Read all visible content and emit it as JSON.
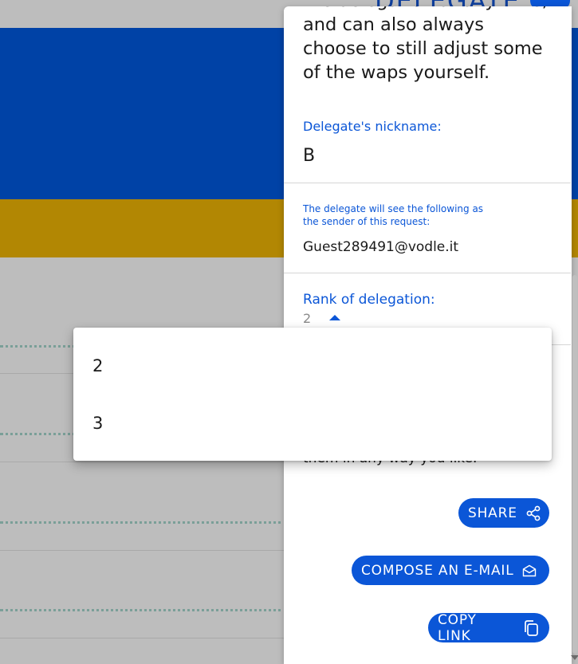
{
  "header": {
    "title": "DELEGATE"
  },
  "panel": {
    "intro_lines": [
      "the delegation at any time,",
      "and can also always",
      "choose to still adjust some",
      "of the waps yourself."
    ],
    "nickname_label": "Delegate's nickname:",
    "nickname_value": "B",
    "sender_label_line1": "The delegate will see the following as",
    "sender_label_line2": "the sender of this request:",
    "sender_value": "Guest289491@vodle.it",
    "rank_label": "Rank of delegation:",
    "rank_value": "2",
    "hidden_text": "them in any way you like.",
    "buttons": {
      "share": "SHARE",
      "email": "COMPOSE AN E-MAIL",
      "copy": "COPY LINK"
    }
  },
  "dropdown": {
    "options": [
      "2",
      "3"
    ]
  },
  "colors": {
    "accent": "#0b56d7",
    "brand_blue": "#0042a6",
    "brand_gold": "#b28703"
  },
  "icons": [
    "share-icon",
    "envelope-icon",
    "copy-icon"
  ]
}
